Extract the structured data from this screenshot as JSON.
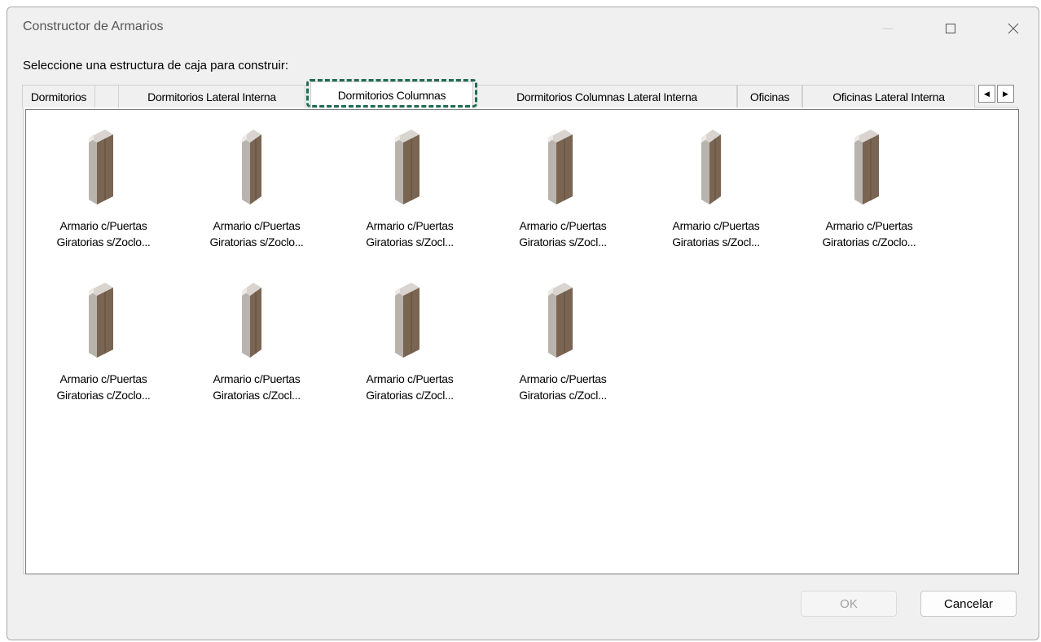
{
  "window": {
    "title": "Constructor de Armarios",
    "controls": [
      "minimize-icon",
      "maximize-icon",
      "close-icon"
    ]
  },
  "prompt": "Seleccione una estructura de caja para construir:",
  "tabs": [
    {
      "label": "Dormitorios",
      "active": false
    },
    {
      "label": "Dormitorios Lateral Interna",
      "active": false
    },
    {
      "label": "Dormitorios Columnas",
      "active": true
    },
    {
      "label": "Dormitorios Columnas Lateral Interna",
      "active": false
    },
    {
      "label": "Oficinas",
      "active": false
    },
    {
      "label": "Oficinas Lateral Interna",
      "active": false
    }
  ],
  "tab_scroll": {
    "left_icon": "arrow-left-icon",
    "right_icon": "arrow-right-icon"
  },
  "items": [
    {
      "line1": "Armario c/Puertas",
      "line2": "Giratorias s/Zoclo..."
    },
    {
      "line1": "Armario c/Puertas",
      "line2": "Giratorias s/Zoclo..."
    },
    {
      "line1": "Armario c/Puertas",
      "line2": "Giratorias s/Zocl..."
    },
    {
      "line1": "Armario c/Puertas",
      "line2": "Giratorias s/Zocl..."
    },
    {
      "line1": "Armario c/Puertas",
      "line2": "Giratorias s/Zocl..."
    },
    {
      "line1": "Armario c/Puertas",
      "line2": "Giratorias c/Zoclo..."
    },
    {
      "line1": "Armario c/Puertas",
      "line2": "Giratorias c/Zoclo..."
    },
    {
      "line1": "Armario c/Puertas",
      "line2": "Giratorias c/Zocl..."
    },
    {
      "line1": "Armario c/Puertas",
      "line2": "Giratorias c/Zocl..."
    },
    {
      "line1": "Armario c/Puertas",
      "line2": "Giratorias c/Zocl..."
    }
  ],
  "buttons": {
    "ok": "OK",
    "cancel": "Cancelar"
  },
  "colors": {
    "focus": "#1e6b54",
    "wood": "#7a6552",
    "carcass": "#c9c4bf"
  }
}
